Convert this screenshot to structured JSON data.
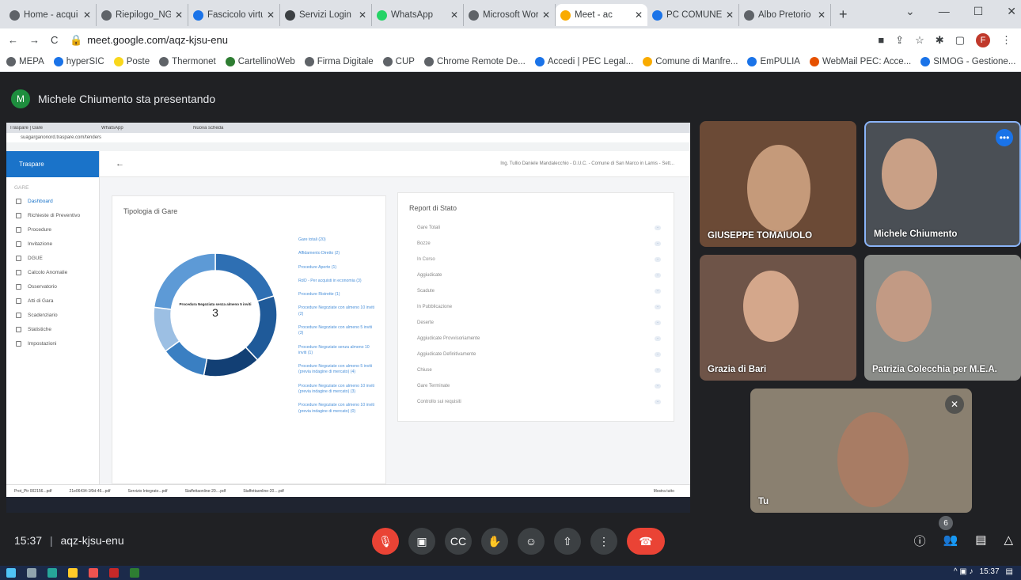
{
  "browser": {
    "tabs": [
      {
        "title": "Home - acqui",
        "color": "#5f6368",
        "active": false
      },
      {
        "title": "Riepilogo_NG",
        "color": "#5f6368",
        "active": false
      },
      {
        "title": "Fascicolo virtu",
        "color": "#1a73e8",
        "active": false
      },
      {
        "title": "Servizi Login",
        "color": "#3c4043",
        "active": false
      },
      {
        "title": "WhatsApp",
        "color": "#25d366",
        "active": false
      },
      {
        "title": "Microsoft Wor",
        "color": "#5f6368",
        "active": false
      },
      {
        "title": "Meet - ac",
        "color": "#f9ab00",
        "active": true
      },
      {
        "title": "PC COMUNE",
        "color": "#1a73e8",
        "active": false
      },
      {
        "title": "Albo Pretorio",
        "color": "#5f6368",
        "active": false
      }
    ],
    "new_tab": "+",
    "url": "meet.google.com/aqz-kjsu-enu",
    "profile_initial": "F",
    "bookmarks": [
      {
        "label": "MEPA",
        "color": "#5f6368"
      },
      {
        "label": "hyperSIC",
        "color": "#1a73e8"
      },
      {
        "label": "Poste",
        "color": "#f9d71c"
      },
      {
        "label": "Thermonet",
        "color": "#5f6368"
      },
      {
        "label": "CartellinoWeb",
        "color": "#2e7d32"
      },
      {
        "label": "Firma Digitale",
        "color": "#5f6368"
      },
      {
        "label": "CUP",
        "color": "#5f6368"
      },
      {
        "label": "Chrome Remote De...",
        "color": "#5f6368"
      },
      {
        "label": "Accedi | PEC Legal...",
        "color": "#1a73e8"
      },
      {
        "label": "Comune di Manfre...",
        "color": "#f9ab00"
      },
      {
        "label": "EmPULIA",
        "color": "#1a73e8"
      },
      {
        "label": "WebMail PEC: Acce...",
        "color": "#e65100"
      },
      {
        "label": "SIMOG - Gestione...",
        "color": "#1a73e8"
      }
    ]
  },
  "meet": {
    "presenter_initial": "M",
    "presenter_text": "Michele Chiumento sta presentando",
    "time": "15:37",
    "code": "aqz-kjsu-enu",
    "participants_count": "6",
    "tiles": [
      {
        "name": "GIUSEPPE TOMAIUOLO"
      },
      {
        "name": "Michele Chiumento"
      },
      {
        "name": "Grazia di Bari"
      },
      {
        "name": "Patrizia Colecchia per M.E.A."
      },
      {
        "name": "Tu"
      }
    ]
  },
  "shared": {
    "app_name": "Traspare",
    "section": "GARE",
    "menu": [
      "Dashboard",
      "Richieste di Preventivo",
      "Procedure",
      "Invitazione",
      "DGUE",
      "Calcolo Anomalie",
      "Osservatorio",
      "Atti di Gara",
      "Scadenziario",
      "Statistiche",
      "Impostazioni"
    ],
    "header_user": "Ing. Tullio Daniele Mandalecchio - D.U.C. - Comune di San Marco in Lamis - Sett...",
    "card1_title": "Tipologia di Gare",
    "donut_label": "Procedura Negoziata senza almeno 5 inviti",
    "donut_value": "3",
    "legend": [
      "Gare totali (20)",
      "Affidamento Diretto (2)",
      "Procedure Aperte (1)",
      "RdO - Per acquisti in economia (3)",
      "Procedure Ristrette (1)",
      "Procedure Negoziate con almeno 10 inviti (2)",
      "Procedure Negoziate con almeno 5 inviti (3)",
      "Procedure Negoziate senza almeno 10 inviti (1)",
      "Procedure Negoziate con almeno 5 inviti (previa indagine di mercato) (4)",
      "Procedure Negoziate con almeno 10 inviti (previa indagine di mercato) (3)",
      "Procedure Negoziate con almeno 10 inviti (previa indagine di mercato) (0)"
    ],
    "donut_slices": [
      {
        "value": 20,
        "color": "#2e6fb3"
      },
      {
        "value": 18,
        "color": "#1f5a99"
      },
      {
        "value": 15,
        "color": "#123f74"
      },
      {
        "value": 12,
        "color": "#3a7fc2"
      },
      {
        "value": 12,
        "color": "#9cbfe3"
      },
      {
        "value": 23,
        "color": "#5d9ad6"
      }
    ],
    "card2_title": "Report di Stato",
    "report_rows": [
      "Gare Totali",
      "Bozze",
      "In Corso",
      "Aggiudicate",
      "Scadute",
      "In Pubblicazione",
      "Deserte",
      "Aggiudicate Provvisoriamente",
      "Aggiudicate Definitivamente",
      "Chiuse",
      "Gare Terminate",
      "Controllo sui requisiti"
    ],
    "downloads": [
      "Prot_Ptr 002156...pdf",
      "21e06434-1f0d-46...pdf",
      "Servizio Integrato...pdf",
      "Staffettaonline-20....pdf",
      "Staffettaonline-20....pdf"
    ],
    "show_all": "Mostra tutto",
    "inner_tabs": [
      "Traspare | Gare",
      "WhatsApp",
      "Nuova scheda"
    ],
    "inner_url": "suagarganonord.traspare.com/tenders"
  },
  "taskbar": {
    "clock": "15:37"
  }
}
